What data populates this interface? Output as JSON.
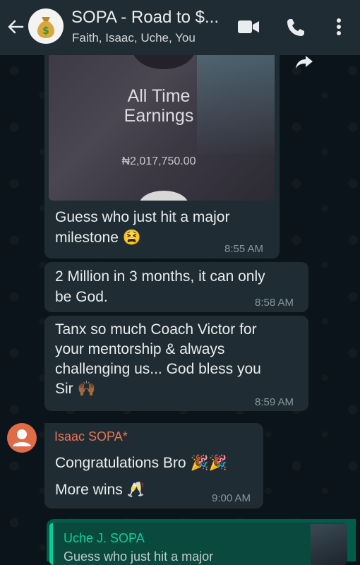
{
  "header": {
    "title": "SOPA - Road to $...",
    "participants": "Faith, Isaac, Uche, You",
    "avatar_icon": "money-bag-icon",
    "colors": {
      "bar": "#202c33",
      "background": "#0b141a"
    }
  },
  "messages": [
    {
      "media": {
        "title_line1": "All Time",
        "title_line2": "Earnings",
        "amount": "₦2,017,750.00"
      },
      "text_line1": "Guess who just hit a major",
      "text_line2": "milestone 😫",
      "time": "8:55 AM"
    },
    {
      "text_line1": "2 Million in 3 months, it can only",
      "text_line2": "be God.",
      "time": "8:58 AM"
    },
    {
      "text_line1": "Tanx so much Coach Victor for",
      "text_line2": "your mentorship & always",
      "text_line3": "challenging us... God bless you",
      "text_line4": "Sir 🙌🏾",
      "time": "8:59 AM"
    },
    {
      "sender": "Isaac SOPA*",
      "text_line1": "Congratulations Bro 🎉🎉",
      "text_line2": "More wins 🥂",
      "time": "9:00 AM"
    }
  ],
  "reply": {
    "quoted_sender": "Uche J. SOPA",
    "quoted_text": "Guess who just hit a major"
  }
}
